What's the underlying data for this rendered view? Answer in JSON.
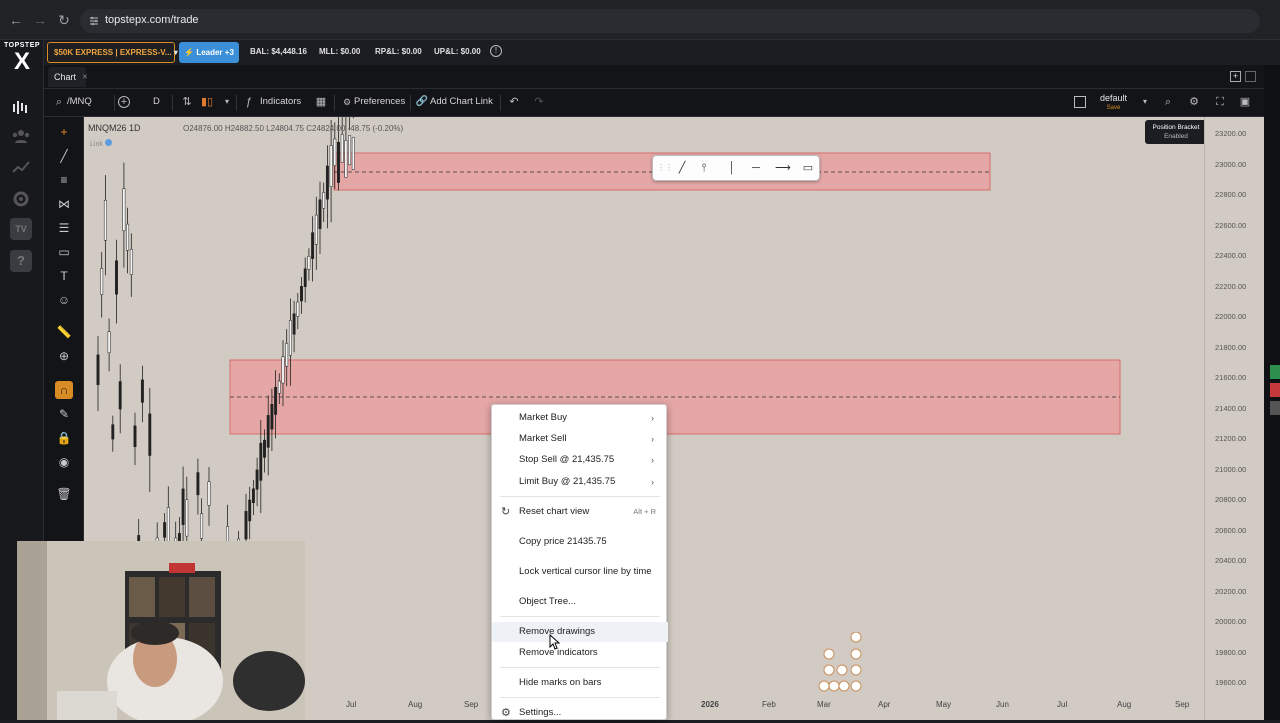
{
  "browser": {
    "url": "topstepx.com/trade"
  },
  "logo": {
    "top_text": "TOPSTEP",
    "mark": "X"
  },
  "account_bar": {
    "account_label": "$50K EXPRESS | EXPRESS-V...",
    "leader_label": "Leader +3",
    "balance": "BAL: $4,448.16",
    "mll": "MLL: $0.00",
    "rpl": "RP&L: $0.00",
    "upl": "UP&L: $0.00"
  },
  "tabs": [
    {
      "label": "Chart"
    }
  ],
  "toolbar": {
    "symbol": "/MNQ",
    "interval": "D",
    "indicators": "Indicators",
    "preferences": "Preferences",
    "add_chart_link": "Add Chart Link",
    "layout_name": "default",
    "layout_sub": "Save"
  },
  "chart": {
    "symbol_line": "MNQM26  1D",
    "link_label": "Link",
    "ohlc": "O24876.00  H24882.50  L24804.75  C24824.00  -48.75 (-0.20%)",
    "position_bracket_title": "Position Bracket",
    "position_bracket_status": "Enabled",
    "price_labels": [
      "23200.00",
      "23000.00",
      "22800.00",
      "22600.00",
      "22400.00",
      "22200.00",
      "22000.00",
      "21800.00",
      "21600.00",
      "21400.00",
      "21200.00",
      "21000.00",
      "20800.00",
      "20600.00",
      "20400.00",
      "20200.00",
      "20000.00",
      "19800.00",
      "19600.00"
    ],
    "time_labels": [
      "Jul",
      "Aug",
      "Sep",
      "2026",
      "Feb",
      "Mar",
      "Apr",
      "May",
      "Jun",
      "Jul",
      "Aug",
      "Sep"
    ]
  },
  "context_menu": {
    "items": [
      {
        "label": "Market Buy",
        "submenu": true
      },
      {
        "label": "Market Sell",
        "submenu": true
      },
      {
        "label": "Stop Sell @ 21,435.75",
        "submenu": true
      },
      {
        "label": "Limit Buy @ 21,435.75",
        "submenu": true
      },
      {
        "label": "Reset chart view",
        "shortcut": "Alt + R"
      },
      {
        "label": "Copy price 21435.75"
      },
      {
        "label": "Lock vertical cursor line by time"
      },
      {
        "label": "Object Tree..."
      },
      {
        "label": "Remove drawings"
      },
      {
        "label": "Remove indicators"
      },
      {
        "label": "Hide marks on bars"
      },
      {
        "label": "Settings..."
      }
    ]
  },
  "colors": {
    "accent_orange": "#d98b26",
    "leader_blue": "#3a8fd8",
    "zone_fill": "#e8a1a1",
    "zone_border": "#d85c5c",
    "chart_bg": "#d1cbc3"
  }
}
